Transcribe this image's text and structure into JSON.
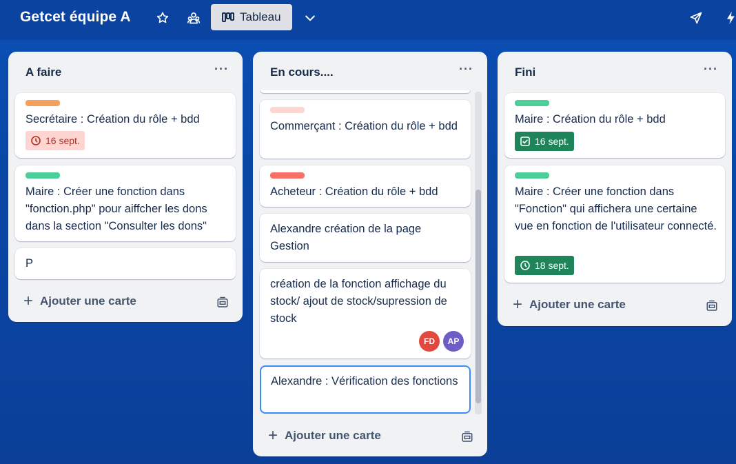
{
  "board": {
    "title": "Getcet équipe A",
    "view_label": "Tableau"
  },
  "icons": {
    "star": "star-icon",
    "visibility": "team-visibility-icon",
    "view": "board-view-icon",
    "chevron": "chevron-down-icon",
    "share": "paper-plane-icon",
    "automation": "lightning-icon"
  },
  "lists": [
    {
      "title": "A faire",
      "add_label": "Ajouter une carte",
      "cards": [
        {
          "label_color": "#f5a05b",
          "text": "Secrétaire : Création du rôle + bdd",
          "due": "16 sept.",
          "due_status": "overdue"
        },
        {
          "label_color": "#4bce97",
          "text": "Maire : Créer une fonction dans \"fonction.php\" pour aiffcher les dons dans la section \"Consulter les dons\""
        },
        {
          "text": "P"
        }
      ]
    },
    {
      "title": "En cours....",
      "add_label": "Ajouter une carte",
      "cards": [
        {
          "label_color": "#ffd5d2",
          "text": "Commerçant : Création du rôle + bdd"
        },
        {
          "label_color": "#f87168",
          "text": "Acheteur : Création du rôle + bdd"
        },
        {
          "text": "Alexandre création de la page Gestion"
        },
        {
          "text": "création de la fonction affichage du stock/ ajout de stock/supression de stock",
          "members": [
            {
              "initials": "FD",
              "color": "#e2483d"
            },
            {
              "initials": "AP",
              "color": "#6e5dc6"
            }
          ]
        },
        {
          "text": "Alexandre : Vérification des fonctions"
        }
      ]
    },
    {
      "title": "Fini",
      "add_label": "Ajouter une carte",
      "cards": [
        {
          "label_color": "#4bce97",
          "text": "Maire : Création du rôle + bdd",
          "due": "16 sept.",
          "due_status": "complete"
        },
        {
          "label_color": "#4bce97",
          "text": "Maire : Créer une fonction dans \"Fonction\" qui affichera une certaine vue en fonction de l'utilisateur connecté.",
          "due": "18 sept.",
          "due_status": "complete"
        }
      ]
    }
  ]
}
